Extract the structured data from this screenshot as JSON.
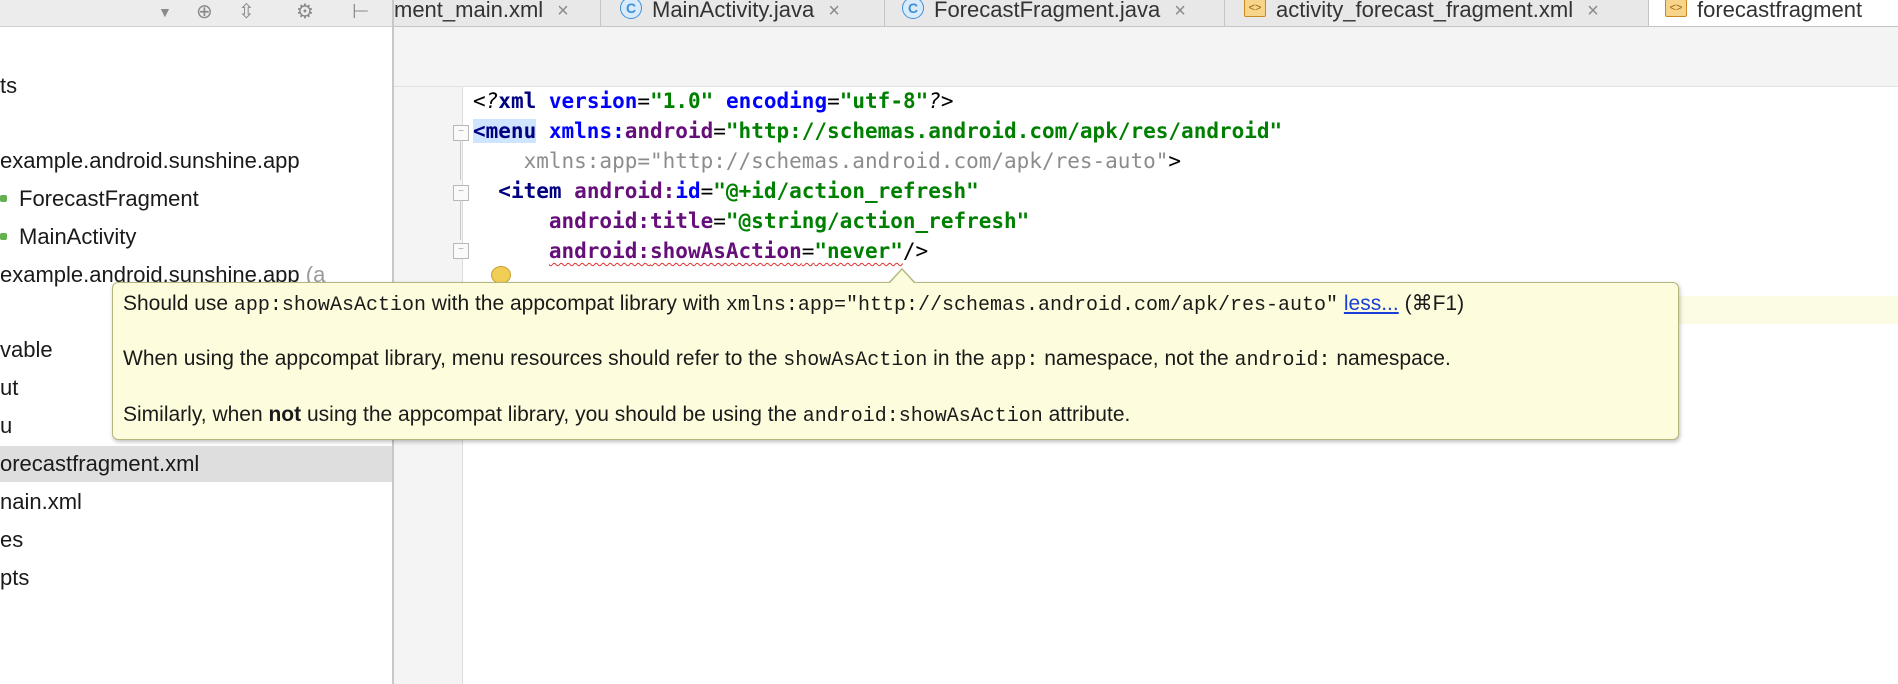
{
  "sidebar": {
    "toolbar_icons": [
      "dropdown-arrow-icon",
      "target-icon",
      "collapse-icon",
      "gear-icon",
      "hide-icon"
    ],
    "items": [
      {
        "label": "ts",
        "kind": "folder"
      },
      {
        "label": "example.android.sunshine.app",
        "kind": "package"
      },
      {
        "label": "ForecastFragment",
        "kind": "class"
      },
      {
        "label": "MainActivity",
        "kind": "class"
      },
      {
        "label": "example.android.sunshine.app",
        "suffix": "(a",
        "kind": "package"
      },
      {
        "label": "vable",
        "kind": "folder"
      },
      {
        "label": "ut",
        "kind": "folder"
      },
      {
        "label": "u",
        "kind": "folder"
      },
      {
        "label": "orecastfragment.xml",
        "kind": "file",
        "selected": true
      },
      {
        "label": "nain.xml",
        "kind": "file"
      },
      {
        "label": "es",
        "kind": "folder"
      },
      {
        "label": "pts",
        "kind": "folder"
      }
    ]
  },
  "tabs": [
    {
      "label": "ment_main.xml",
      "icon": "xml-file-icon"
    },
    {
      "label": "MainActivity.java",
      "icon": "java-class-icon"
    },
    {
      "label": "ForecastFragment.java",
      "icon": "java-class-icon"
    },
    {
      "label": "activity_forecast_fragment.xml",
      "icon": "xml-file-icon"
    },
    {
      "label": "forecastfragment",
      "icon": "xml-file-icon",
      "active": true
    }
  ],
  "tab_close_glyph": "×",
  "code": {
    "line1": {
      "open": "<?",
      "name": "xml",
      "a1": "version",
      "v1": "\"1.0\"",
      "a2": "encoding",
      "v2": "\"utf-8\"",
      "close": "?>"
    },
    "line2": {
      "tag": "<menu",
      "ns": "xmlns:",
      "attr": "android",
      "eq": "=",
      "val": "\"http://schemas.android.com/apk/res/android\""
    },
    "line3": {
      "text": "xmlns:app=\"http://schemas.android.com/apk/res-auto\"",
      "close": ">"
    },
    "line4": {
      "tag": "<item",
      "ns": "android:",
      "attr": "id",
      "eq": "=",
      "val": "\"@+id/action_refresh\""
    },
    "line5": {
      "ns": "android:",
      "attr": "title",
      "eq": "=",
      "val": "\"@string/action_refresh\""
    },
    "line6": {
      "ns": "android:",
      "attr": "showAsAction",
      "eq": "=",
      "val": "\"never\"",
      "close": "/>"
    }
  },
  "tooltip": {
    "line1": {
      "t1": "Should use ",
      "c1": "app:showAsAction",
      "t2": " with the appcompat library with ",
      "c2": "xmlns:app=\"http://schemas.android.com/apk/res-auto\"",
      "link": "less...",
      "shortcut": "(⌘F1)"
    },
    "line2": {
      "t1": "When using the appcompat library, menu resources should refer to the ",
      "c1": "showAsAction",
      "t2": " in the ",
      "c2": "app:",
      "t3": " namespace, not the ",
      "c3": "android:",
      "t4": " namespace."
    },
    "line3": {
      "t1": "Similarly, when ",
      "b1": "not",
      "t2": " using the appcompat library, you should be using the ",
      "c1": "android:showAsAction",
      "t3": " attribute."
    }
  }
}
